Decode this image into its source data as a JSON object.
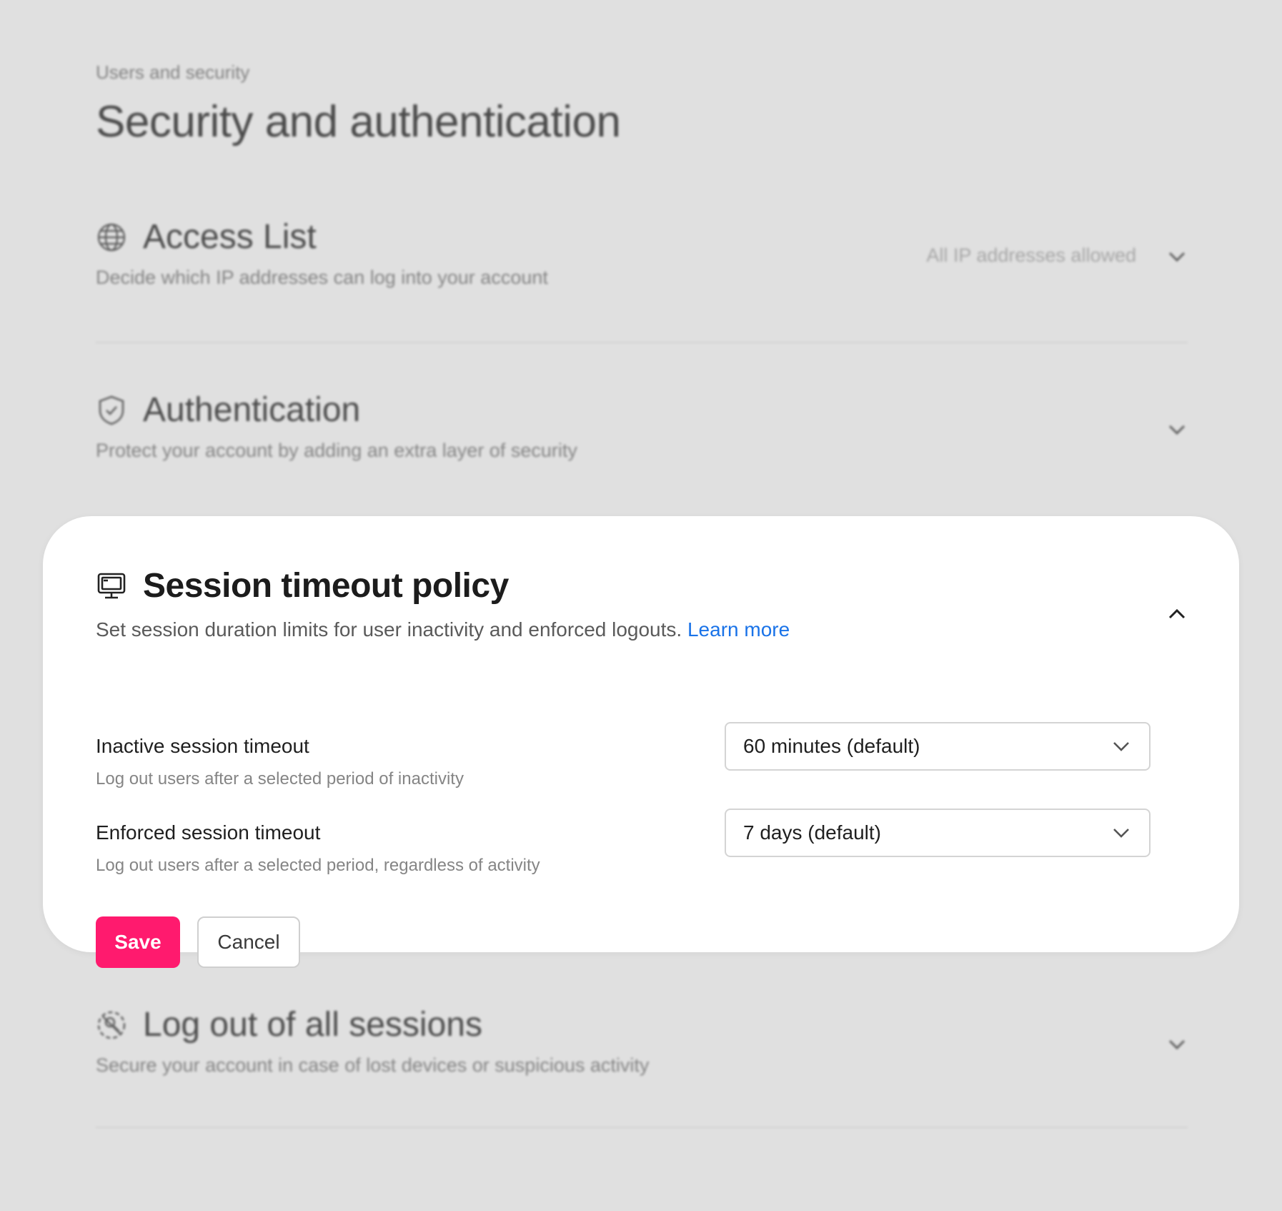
{
  "header": {
    "breadcrumb": "Users and security",
    "title": "Security and authentication"
  },
  "sections": {
    "access_list": {
      "title": "Access List",
      "description": "Decide which IP addresses can log into your account",
      "status": "All IP addresses allowed",
      "icon": "globe-icon"
    },
    "authentication": {
      "title": "Authentication",
      "description": "Protect your account by adding an extra layer of security",
      "icon": "shield-check-icon"
    },
    "session_timeout": {
      "title": "Session timeout policy",
      "description": "Set session duration limits for user inactivity and enforced logouts.",
      "learn_more": "Learn more",
      "icon": "monitor-icon",
      "inactive": {
        "label": "Inactive session timeout",
        "help": "Log out users after a selected period of inactivity",
        "value": "60 minutes (default)"
      },
      "enforced": {
        "label": "Enforced session timeout",
        "help": "Log out users after a selected period, regardless of activity",
        "value": "7 days (default)"
      },
      "save_label": "Save",
      "cancel_label": "Cancel"
    },
    "logout_all": {
      "title": "Log out of all sessions",
      "description": "Secure your account in case of lost devices or suspicious activity",
      "icon": "logout-sessions-icon"
    }
  },
  "colors": {
    "background": "#e0e0e0",
    "card": "#ffffff",
    "primary": "#ff1a6e",
    "link": "#1a73e8"
  }
}
